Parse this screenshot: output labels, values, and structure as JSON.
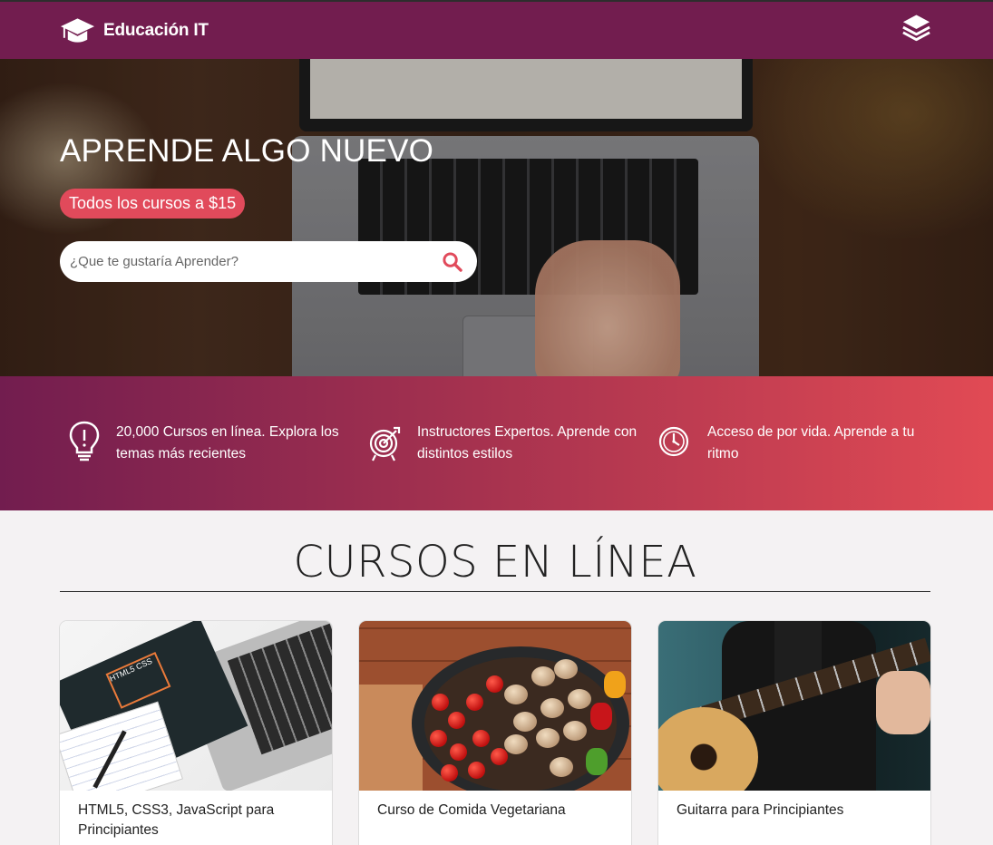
{
  "header": {
    "brand_name": "Educación IT",
    "logo_icon": "graduation-cap-icon",
    "menu_icon": "layers-icon",
    "bar_color": "#721d4f"
  },
  "hero": {
    "title": "APRENDE ALGO NUEVO",
    "promo_badge": "Todos los cursos a $15",
    "search": {
      "placeholder": "¿Que te gustaría Aprender?",
      "value": "",
      "icon": "search-icon"
    },
    "accent_color": "#e14a5b"
  },
  "features": [
    {
      "icon": "lightbulb-icon",
      "text": "20,000 Cursos en línea. Explora los temas más recientes"
    },
    {
      "icon": "target-icon",
      "text": "Instructores Expertos. Aprende con distintos estilos"
    },
    {
      "icon": "clock-icon",
      "text": "Acceso de por vida. Aprende a tu ritmo"
    }
  ],
  "courses": {
    "section_title": "CURSOS EN LÍNEA",
    "items": [
      {
        "title": "HTML5, CSS3, JavaScript para Principiantes",
        "image": "html-css-laptop-image"
      },
      {
        "title": "Curso de Comida Vegetariana",
        "image": "vegetables-pot-image"
      },
      {
        "title": "Guitarra para Principiantes",
        "image": "guitar-player-image"
      }
    ]
  }
}
